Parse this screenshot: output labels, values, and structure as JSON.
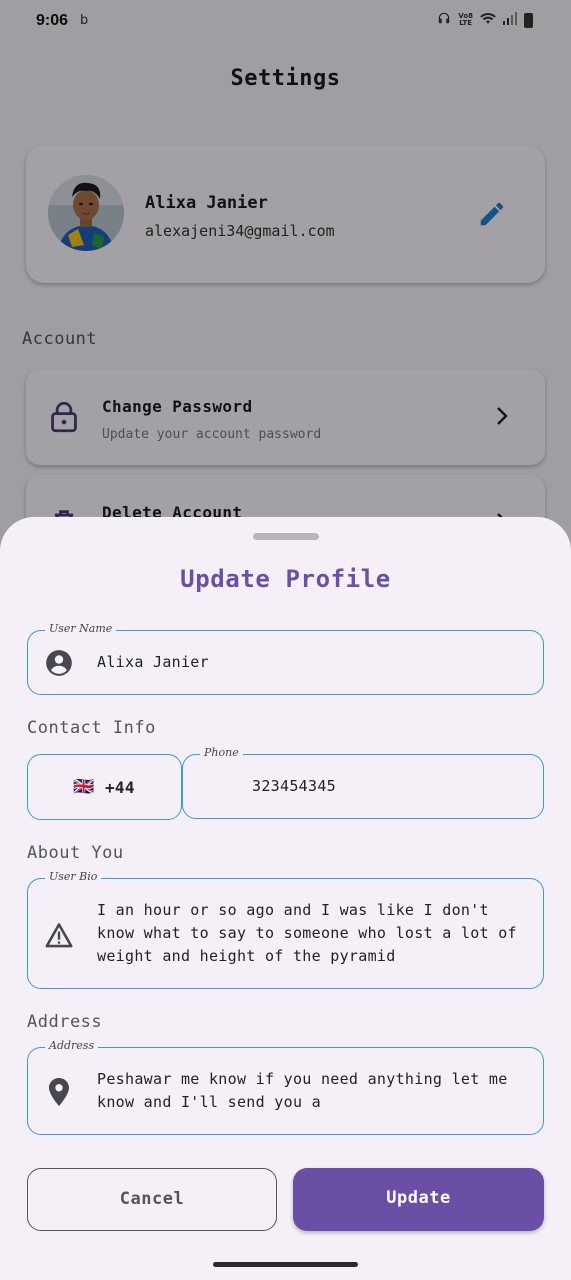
{
  "status_bar": {
    "time": "9:06",
    "left_icon": "bing-icon",
    "right_icons": [
      "headphones-icon",
      "volte-lte-icon",
      "wifi-icon",
      "signal-icon",
      "battery-icon"
    ],
    "volte_label": "Vo8 LTE"
  },
  "settings": {
    "title": "Settings",
    "profile": {
      "name": "Alixa Janier",
      "email": "alexajeni34@gmail.com",
      "edit_icon": "pencil-icon"
    },
    "section_account": "Account",
    "items": [
      {
        "title": "Change Password",
        "subtitle": "Update your account password",
        "icon": "lock-icon"
      },
      {
        "title": "Delete Account",
        "subtitle": "",
        "icon": "trash-icon"
      }
    ]
  },
  "sheet": {
    "title": "Update Profile",
    "user_name": {
      "label": "User Name",
      "value": "Alixa Janier",
      "icon": "account-circle-icon"
    },
    "contact_section": "Contact Info",
    "country": {
      "flag": "🇬🇧",
      "code": "+44"
    },
    "phone": {
      "label": "Phone",
      "value": "323454345"
    },
    "about_section": "About You",
    "bio": {
      "label": "User Bio",
      "value": "I an hour or so ago and I was like I don't know what to say to someone who lost a lot of weight and height of the pyramid",
      "icon": "warning-icon"
    },
    "address_section": "Address",
    "address": {
      "label": "Address",
      "value": "Peshawar me know if you need anything let me know and I'll send you a",
      "icon": "location-pin-icon"
    },
    "cancel_label": "Cancel",
    "update_label": "Update"
  },
  "colors": {
    "accent": "#6b4fa4",
    "field_border": "#3b9bd6",
    "edit_icon": "#1e7fd0",
    "sheet_bg": "#f5f0f8"
  }
}
